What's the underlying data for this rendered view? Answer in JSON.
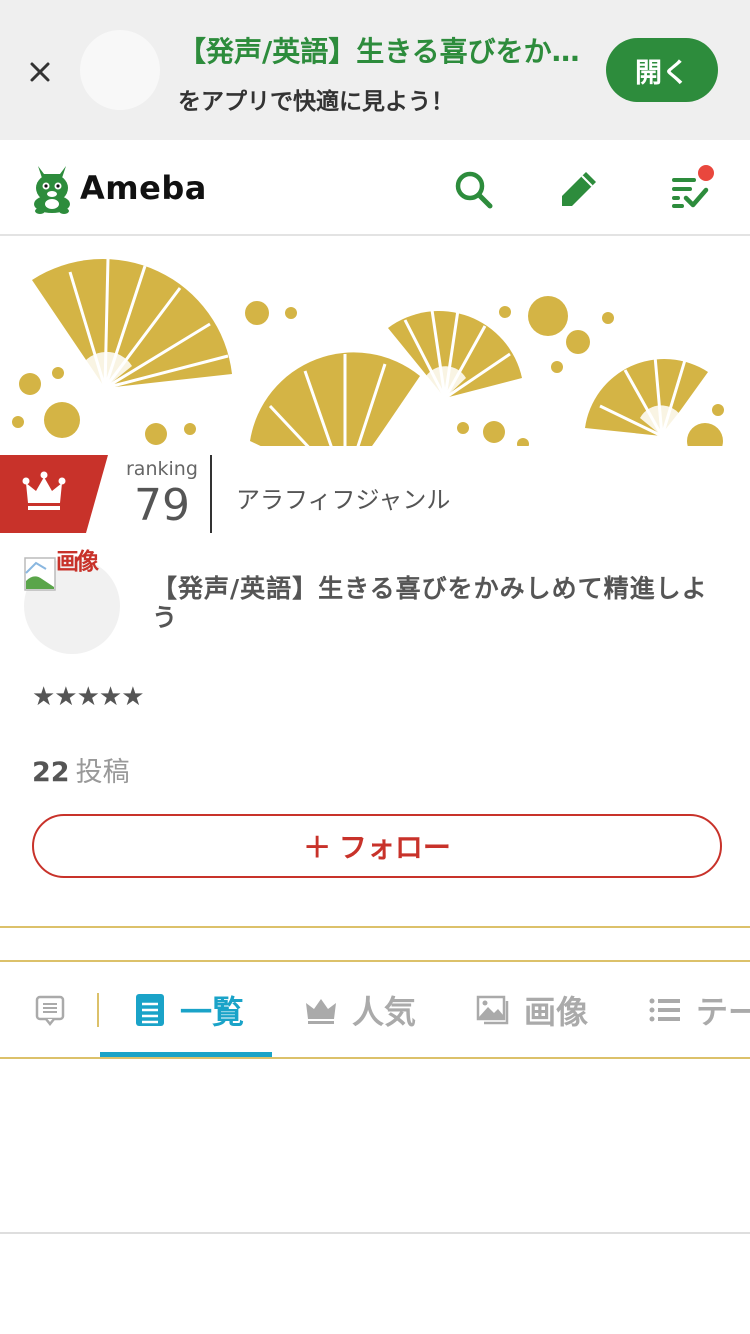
{
  "app_banner": {
    "title": "【発声/英語】生きる喜びをかみしめて精進しよう",
    "subtitle": "をアプリで快適に見よう！",
    "open_label": "開く"
  },
  "header": {
    "logo_text": "Ameba",
    "icons": [
      "search-icon",
      "pencil-icon",
      "checklist-icon"
    ],
    "has_notification": true
  },
  "ranking": {
    "label": "ranking",
    "value": "79",
    "genre": "アラフィフジャンル"
  },
  "profile": {
    "avatar_alt": "画像",
    "blog_title": "【発声/英語】生きる喜びをかみしめて精進しよう",
    "stars": "★★★★★",
    "post_count": "22",
    "post_label": "投稿",
    "follow_label": "＋ フォロー"
  },
  "tabs": [
    {
      "label": "",
      "icon": "message-icon"
    },
    {
      "label": "一覧",
      "icon": "document-icon",
      "active": true
    },
    {
      "label": "人気",
      "icon": "crown-icon"
    },
    {
      "label": "画像",
      "icon": "image-icon"
    },
    {
      "label": "テーマ",
      "icon": "list-icon"
    }
  ],
  "colors": {
    "brand_green": "#2d8c3c",
    "accent_red": "#c8322a",
    "tab_active": "#1aa3c8",
    "gold": "#d4b445"
  }
}
